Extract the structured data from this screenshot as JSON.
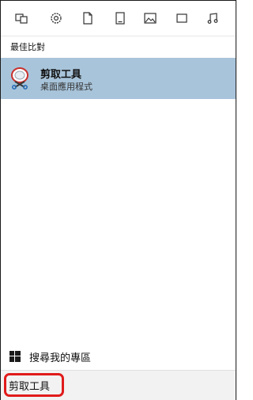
{
  "filters": {
    "items": [
      {
        "icon": "apps-icon"
      },
      {
        "icon": "settings-icon"
      },
      {
        "icon": "documents-icon"
      },
      {
        "icon": "folders-icon"
      },
      {
        "icon": "photos-icon"
      },
      {
        "icon": "videos-icon"
      },
      {
        "icon": "music-icon"
      }
    ]
  },
  "results": {
    "section_title": "最佳比對",
    "best_match": {
      "name": "剪取工具",
      "subtitle": "桌面應用程式",
      "icon": "snipping-tool-icon"
    }
  },
  "store_search": {
    "label": "搜尋我的專區",
    "icon": "windows-logo-icon"
  },
  "search": {
    "value": "剪取工具",
    "highlight_color": "#e11b1b"
  }
}
